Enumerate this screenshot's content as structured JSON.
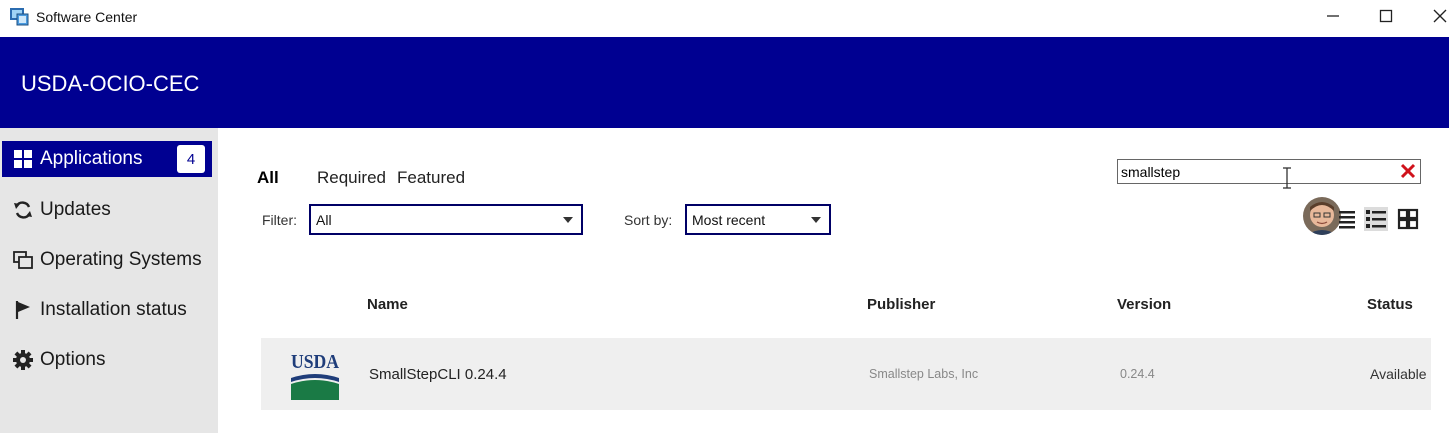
{
  "window": {
    "title": "Software Center",
    "controls": [
      "minimize-icon",
      "maximize-icon",
      "close-icon"
    ]
  },
  "header": {
    "org_name": "USDA-OCIO-CEC",
    "color": "#000091"
  },
  "sidebar": {
    "items": [
      {
        "label": "Applications",
        "icon": "grid-icon",
        "badge": "4",
        "active": true
      },
      {
        "label": "Updates",
        "icon": "refresh-icon"
      },
      {
        "label": "Operating Systems",
        "icon": "windows-stack-icon"
      },
      {
        "label": "Installation status",
        "icon": "flag-icon"
      },
      {
        "label": "Options",
        "icon": "gear-icon"
      }
    ]
  },
  "tabs": [
    {
      "label": "All",
      "active": true
    },
    {
      "label": "Required"
    },
    {
      "label": "Featured"
    }
  ],
  "search": {
    "value": "smallstep"
  },
  "filter": {
    "label": "Filter:",
    "selected": "All"
  },
  "sort": {
    "label": "Sort by:",
    "selected": "Most recent"
  },
  "view_icons": [
    "details-view-icon",
    "list-view-icon",
    "tile-view-icon"
  ],
  "table": {
    "columns": [
      "Name",
      "Publisher",
      "Version",
      "Status"
    ],
    "rows": [
      {
        "logo_text": "USDA",
        "name": "SmallStepCLI 0.24.4",
        "publisher": "Smallstep Labs, Inc",
        "version": "0.24.4",
        "status": "Available"
      }
    ]
  }
}
